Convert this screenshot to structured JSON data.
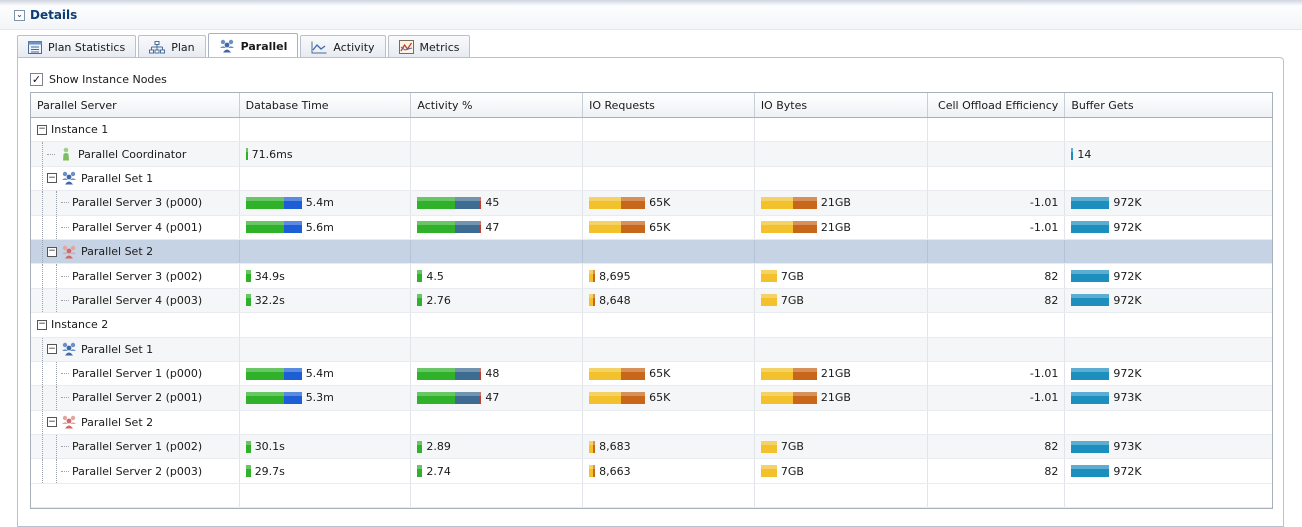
{
  "section": {
    "title": "Details"
  },
  "tabs": [
    {
      "label": "Plan Statistics",
      "icon": "table-icon"
    },
    {
      "label": "Plan",
      "icon": "plan-tree-icon"
    },
    {
      "label": "Parallel",
      "icon": "people-group-icon",
      "active": true
    },
    {
      "label": "Activity",
      "icon": "line-chart-icon"
    },
    {
      "label": "Metrics",
      "icon": "metrics-chart-icon"
    }
  ],
  "show_instance_nodes": {
    "label": "Show Instance Nodes",
    "checked": true
  },
  "columns": [
    "Parallel Server",
    "Database Time",
    "Activity %",
    "IO Requests",
    "IO Bytes",
    "Cell Offload Efficiency",
    "Buffer Gets"
  ],
  "colors": {
    "bar_green": "#2fb12a",
    "bar_blue": "#1d5ed6",
    "bar_steel": "#3e6b91",
    "bar_red": "#c23b2b",
    "bar_yellow": "#f2c12b",
    "bar_orange": "#c8661a",
    "bar_cyan": "#1c8fbf",
    "selected_row": "#c6d3e5"
  },
  "rows": [
    {
      "name": "Instance 1",
      "level": 0,
      "type": "instance",
      "expander": true
    },
    {
      "name": "Parallel Coordinator",
      "level": 1,
      "type": "coordinator",
      "db_time": "71.6ms",
      "buffer_gets": "14"
    },
    {
      "name": "Parallel Set 1",
      "level": 1,
      "type": "set1",
      "expander": true
    },
    {
      "name": "Parallel Server 3 (p000)",
      "level": 2,
      "type": "server",
      "db_time": "5.4m",
      "activity": "45",
      "io_req": "65K",
      "io_bytes": "21GB",
      "offload": "-1.01",
      "buffer_gets": "972K",
      "big": true
    },
    {
      "name": "Parallel Server 4 (p001)",
      "level": 2,
      "type": "server",
      "db_time": "5.6m",
      "activity": "47",
      "io_req": "65K",
      "io_bytes": "21GB",
      "offload": "-1.01",
      "buffer_gets": "972K",
      "big": true
    },
    {
      "name": "Parallel Set 2",
      "level": 1,
      "type": "set2",
      "expander": true,
      "selected": true
    },
    {
      "name": "Parallel Server 3 (p002)",
      "level": 2,
      "type": "server",
      "db_time": "34.9s",
      "activity": "4.5",
      "io_req": "8,695",
      "io_bytes": "7GB",
      "offload": "82",
      "buffer_gets": "972K"
    },
    {
      "name": "Parallel Server 4 (p003)",
      "level": 2,
      "type": "server",
      "db_time": "32.2s",
      "activity": "2.76",
      "io_req": "8,648",
      "io_bytes": "7GB",
      "offload": "82",
      "buffer_gets": "972K"
    },
    {
      "name": "Instance 2",
      "level": 0,
      "type": "instance",
      "expander": true
    },
    {
      "name": "Parallel Set 1",
      "level": 1,
      "type": "set1",
      "expander": true
    },
    {
      "name": "Parallel Server 1 (p000)",
      "level": 2,
      "type": "server",
      "db_time": "5.4m",
      "activity": "48",
      "io_req": "65K",
      "io_bytes": "21GB",
      "offload": "-1.01",
      "buffer_gets": "972K",
      "big": true
    },
    {
      "name": "Parallel Server 2 (p001)",
      "level": 2,
      "type": "server",
      "db_time": "5.3m",
      "activity": "47",
      "io_req": "65K",
      "io_bytes": "21GB",
      "offload": "-1.01",
      "buffer_gets": "973K",
      "big": true
    },
    {
      "name": "Parallel Set 2",
      "level": 1,
      "type": "set2",
      "expander": true
    },
    {
      "name": "Parallel Server 1 (p002)",
      "level": 2,
      "type": "server",
      "db_time": "30.1s",
      "activity": "2.89",
      "io_req": "8,683",
      "io_bytes": "7GB",
      "offload": "82",
      "buffer_gets": "973K"
    },
    {
      "name": "Parallel Server 2 (p003)",
      "level": 2,
      "type": "server",
      "db_time": "29.7s",
      "activity": "2.74",
      "io_req": "8,663",
      "io_bytes": "7GB",
      "offload": "82",
      "buffer_gets": "972K"
    }
  ]
}
